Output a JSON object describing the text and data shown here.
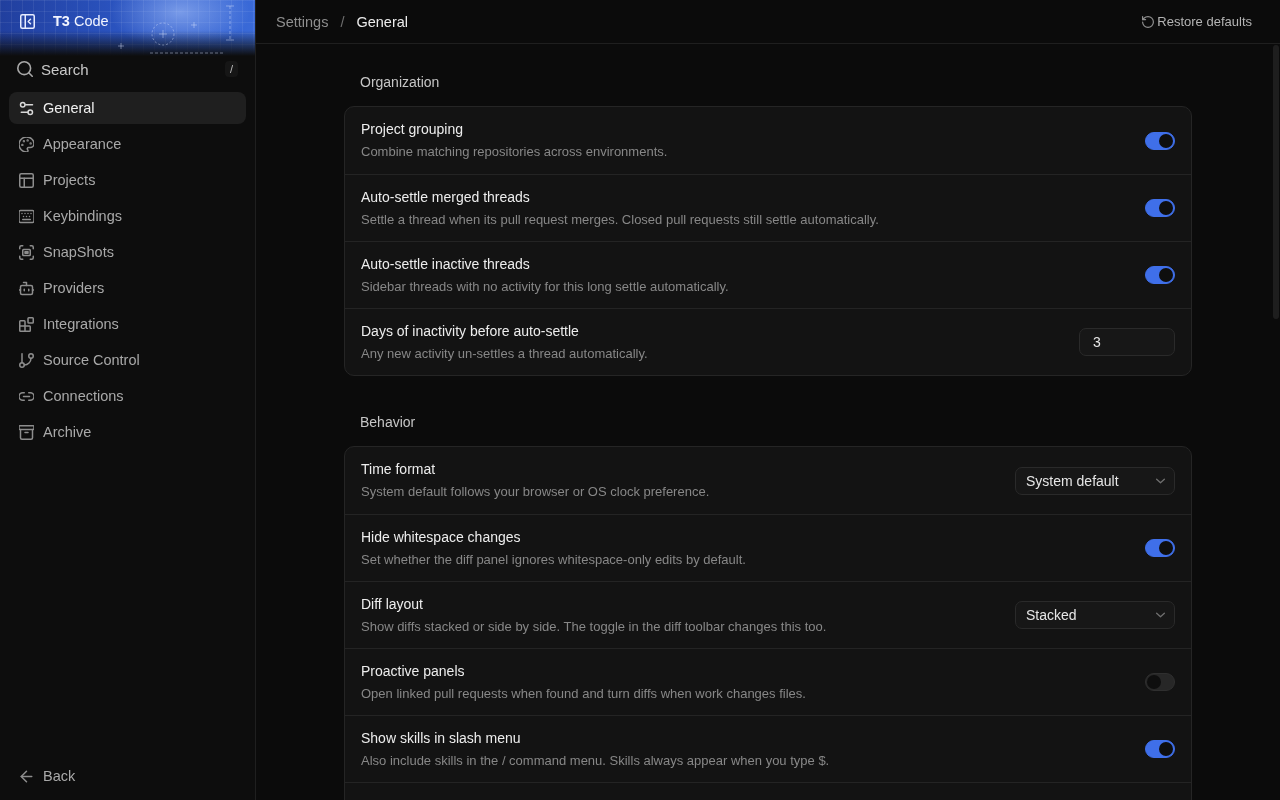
{
  "sidebar": {
    "brand": "**T3** Code",
    "search": {
      "label": "Search",
      "shortcut": "/"
    },
    "items": [
      {
        "label": "General",
        "selected": true
      },
      {
        "label": "Appearance",
        "selected": false
      },
      {
        "label": "Projects",
        "selected": false
      },
      {
        "label": "Keybindings",
        "selected": false
      },
      {
        "label": "SnapShots",
        "selected": false
      },
      {
        "label": "Providers",
        "selected": false
      },
      {
        "label": "Integrations",
        "selected": false
      },
      {
        "label": "Source Control",
        "selected": false
      },
      {
        "label": "Connections",
        "selected": false
      },
      {
        "label": "Archive",
        "selected": false
      }
    ],
    "back": "Back"
  },
  "topbar": {
    "breadcrumb": [
      "Settings",
      "General"
    ],
    "separator": "/",
    "restore": "Restore defaults"
  },
  "sections": [
    {
      "title": "Organization",
      "rows": [
        {
          "kind": "toggle",
          "title": "Project grouping",
          "description": "Combine matching repositories across environments.",
          "on": true
        },
        {
          "kind": "toggle",
          "title": "Auto-settle merged threads",
          "description": "Settle a thread when its pull request merges. Closed pull requests still settle automatically.",
          "on": true
        },
        {
          "kind": "toggle",
          "title": "Auto-settle inactive threads",
          "description": "Sidebar threads with no activity for this long settle automatically.",
          "on": true
        },
        {
          "kind": "number",
          "title": "Days of inactivity before auto-settle",
          "description": "Any new activity un-settles a thread automatically.",
          "value": "3"
        }
      ]
    },
    {
      "title": "Behavior",
      "rows": [
        {
          "kind": "select",
          "title": "Time format",
          "description": "System default follows your browser or OS clock preference.",
          "value": "System default"
        },
        {
          "kind": "toggle",
          "title": "Hide whitespace changes",
          "description": "Set whether the diff panel ignores whitespace-only edits by default.",
          "on": true
        },
        {
          "kind": "select",
          "title": "Diff layout",
          "description": "Show diffs stacked or side by side. The toggle in the diff toolbar changes this too.",
          "value": "Stacked"
        },
        {
          "kind": "toggle",
          "title": "Proactive panels",
          "description": "Open linked pull requests when found and turn diffs when work changes files.",
          "on": false
        },
        {
          "kind": "toggle",
          "title": "Show skills in slash menu",
          "description": "Also include skills in the / command menu. Skills always appear when you type $.",
          "on": true
        }
      ]
    }
  ]
}
